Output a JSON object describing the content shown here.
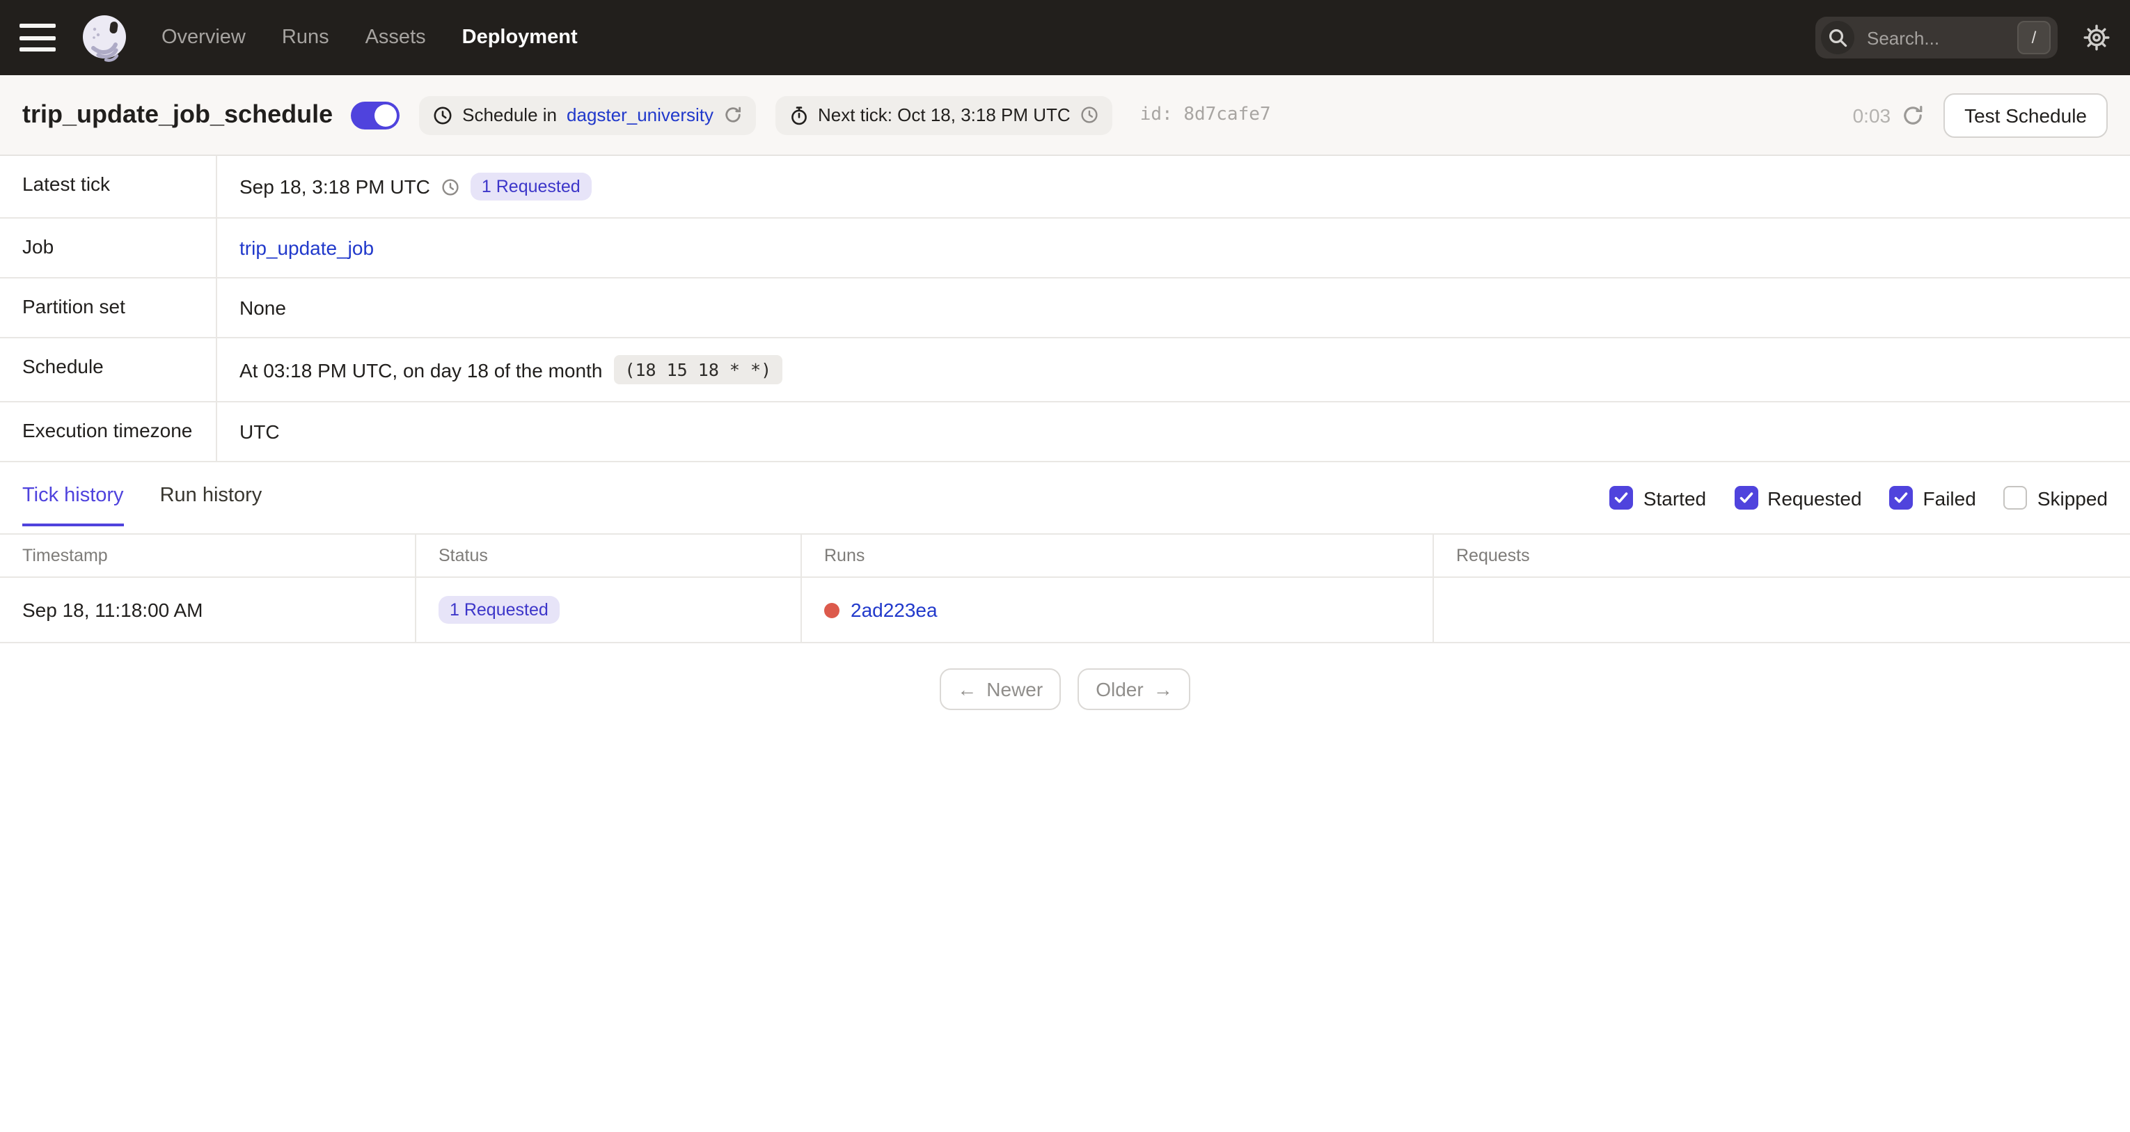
{
  "nav": {
    "links": [
      {
        "label": "Overview",
        "active": false
      },
      {
        "label": "Runs",
        "active": false
      },
      {
        "label": "Assets",
        "active": false
      },
      {
        "label": "Deployment",
        "active": true
      }
    ],
    "search": {
      "placeholder": "Search...",
      "shortcut": "/"
    }
  },
  "header": {
    "title": "trip_update_job_schedule",
    "toggle_on": true,
    "schedule_location": {
      "prefix": "Schedule in",
      "repository": "dagster_university"
    },
    "next_tick": "Next tick: Oct 18, 3:18 PM UTC",
    "id_label": "id:",
    "id_value": "8d7cafe7",
    "refresh_countdown": "0:03",
    "test_schedule_label": "Test Schedule"
  },
  "details": {
    "latest_tick": {
      "label": "Latest tick",
      "time": "Sep 18, 3:18 PM UTC",
      "badge": "1 Requested"
    },
    "job": {
      "label": "Job",
      "link": "trip_update_job"
    },
    "partition_set": {
      "label": "Partition set",
      "value": "None"
    },
    "schedule": {
      "label": "Schedule",
      "description": "At 03:18 PM UTC, on day 18 of the month",
      "cron": "(18 15 18 * *)"
    },
    "timezone": {
      "label": "Execution timezone",
      "value": "UTC"
    }
  },
  "tabs": [
    {
      "label": "Tick history",
      "active": true
    },
    {
      "label": "Run history",
      "active": false
    }
  ],
  "filters": [
    {
      "label": "Started",
      "checked": true
    },
    {
      "label": "Requested",
      "checked": true
    },
    {
      "label": "Failed",
      "checked": true
    },
    {
      "label": "Skipped",
      "checked": false
    }
  ],
  "tick_table": {
    "columns": [
      "Timestamp",
      "Status",
      "Runs",
      "Requests"
    ],
    "rows": [
      {
        "timestamp": "Sep 18, 11:18:00 AM",
        "status": "1 Requested",
        "run_id": "2ad223ea",
        "requests": ""
      }
    ]
  },
  "pagination": {
    "left_arrow": "←",
    "newer": "Newer",
    "older": "Older",
    "right_arrow": "→"
  },
  "colors": {
    "accent": "#4F43DD",
    "link": "#2139CB",
    "badge_bg": "#E7E4F8",
    "badge_text": "#3D36C9",
    "run_status_red": "#DC5A4C",
    "nav_bg": "#221F1C",
    "titlebar_bg": "#F9F7F5"
  }
}
